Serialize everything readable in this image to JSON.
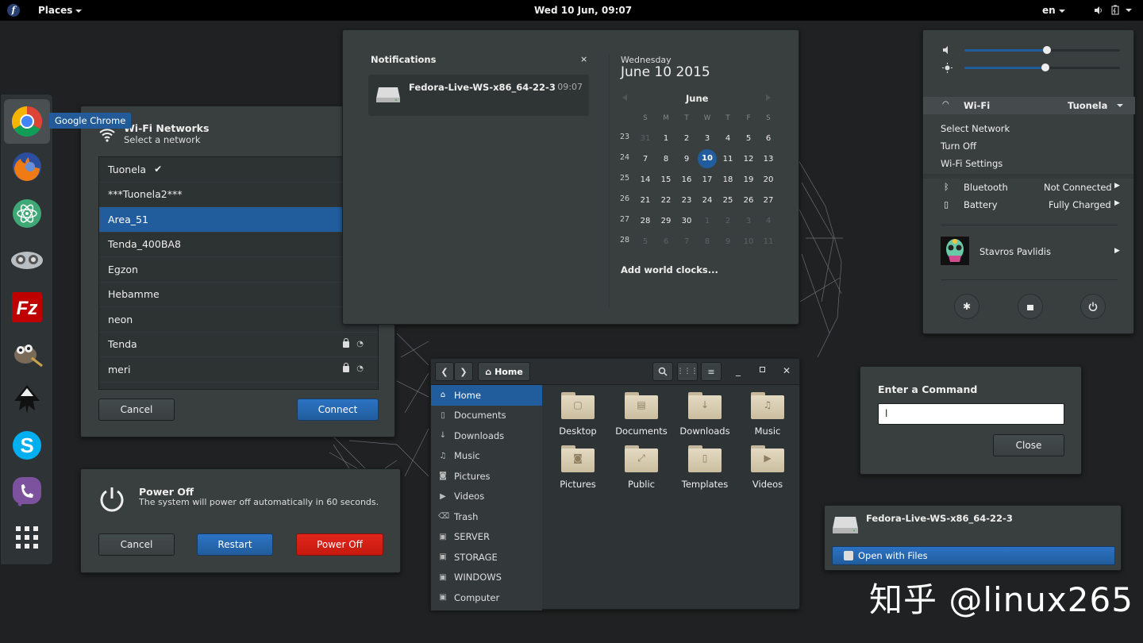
{
  "topbar": {
    "places": "Places",
    "clock": "Wed 10 Jun, 09:07",
    "lang": "en"
  },
  "dash": {
    "tooltip": "Google Chrome",
    "apps": [
      "chrome",
      "firefox",
      "atom",
      "viewer",
      "filezilla",
      "gimp",
      "inkscape",
      "skype",
      "viber",
      "show-apps"
    ]
  },
  "wifi": {
    "title": "Wi-Fi Networks",
    "subtitle": "Select a network",
    "networks": [
      {
        "name": "Tuonela",
        "connected": "✔"
      },
      {
        "name": "***Tuonela2***"
      },
      {
        "name": "Area_51",
        "selected": true
      },
      {
        "name": "Tenda_400BA8"
      },
      {
        "name": "Egzon"
      },
      {
        "name": "Hebamme"
      },
      {
        "name": "neon"
      },
      {
        "name": "Tenda"
      },
      {
        "name": "meri"
      }
    ],
    "cancel": "Cancel",
    "connect": "Connect"
  },
  "power": {
    "title": "Power Off",
    "message": "The system will power off automatically in 60 seconds.",
    "cancel": "Cancel",
    "restart": "Restart",
    "poweroff": "Power Off"
  },
  "notifications": {
    "header": "Notifications",
    "close": "×",
    "item_title": "Fedora-Live-WS-x86_64-22-3",
    "item_time": "09:07"
  },
  "calendar": {
    "weekday": "Wednesday",
    "date": "June 10 2015",
    "month": "June",
    "day_headers": [
      "S",
      "M",
      "T",
      "W",
      "T",
      "F",
      "S"
    ],
    "week_numbers": [
      "23",
      "24",
      "25",
      "26",
      "27",
      "28"
    ],
    "weeks": [
      [
        "31",
        "1",
        "2",
        "3",
        "4",
        "5",
        "6"
      ],
      [
        "7",
        "8",
        "9",
        "10",
        "11",
        "12",
        "13"
      ],
      [
        "14",
        "15",
        "16",
        "17",
        "18",
        "19",
        "20"
      ],
      [
        "21",
        "22",
        "23",
        "24",
        "25",
        "26",
        "27"
      ],
      [
        "28",
        "29",
        "30",
        "1",
        "2",
        "3",
        "4"
      ],
      [
        "5",
        "6",
        "7",
        "8",
        "9",
        "10",
        "11"
      ]
    ],
    "today": "10",
    "world_clocks": "Add world clocks..."
  },
  "files": {
    "location": "Home",
    "sidebar": [
      "Home",
      "Documents",
      "Downloads",
      "Music",
      "Pictures",
      "Videos",
      "Trash",
      "SERVER",
      "STORAGE",
      "WINDOWS",
      "Computer"
    ],
    "folders": [
      "Desktop",
      "Documents",
      "Downloads",
      "Music",
      "Pictures",
      "Public",
      "Templates",
      "Videos"
    ]
  },
  "sysmenu": {
    "volume_level": 0.53,
    "brightness_level": 0.52,
    "wifi_label": "Wi-Fi",
    "wifi_network": "Tuonela",
    "wifi_items": [
      "Select Network",
      "Turn Off",
      "Wi-Fi Settings"
    ],
    "bluetooth_label": "Bluetooth",
    "bluetooth_status": "Not Connected",
    "battery_label": "Battery",
    "battery_status": "Fully Charged",
    "user": "Stavros Pavlidis"
  },
  "run": {
    "title": "Enter a Command",
    "value": "l",
    "close": "Close"
  },
  "drive": {
    "title": "Fedora-Live-WS-x86_64-22-3",
    "open": "Open with Files"
  },
  "watermark": "知乎 @linux265",
  "colors": {
    "accent": "#215d9c",
    "danger": "#e2261b",
    "panel": "#393f3f",
    "background": "#202122"
  }
}
